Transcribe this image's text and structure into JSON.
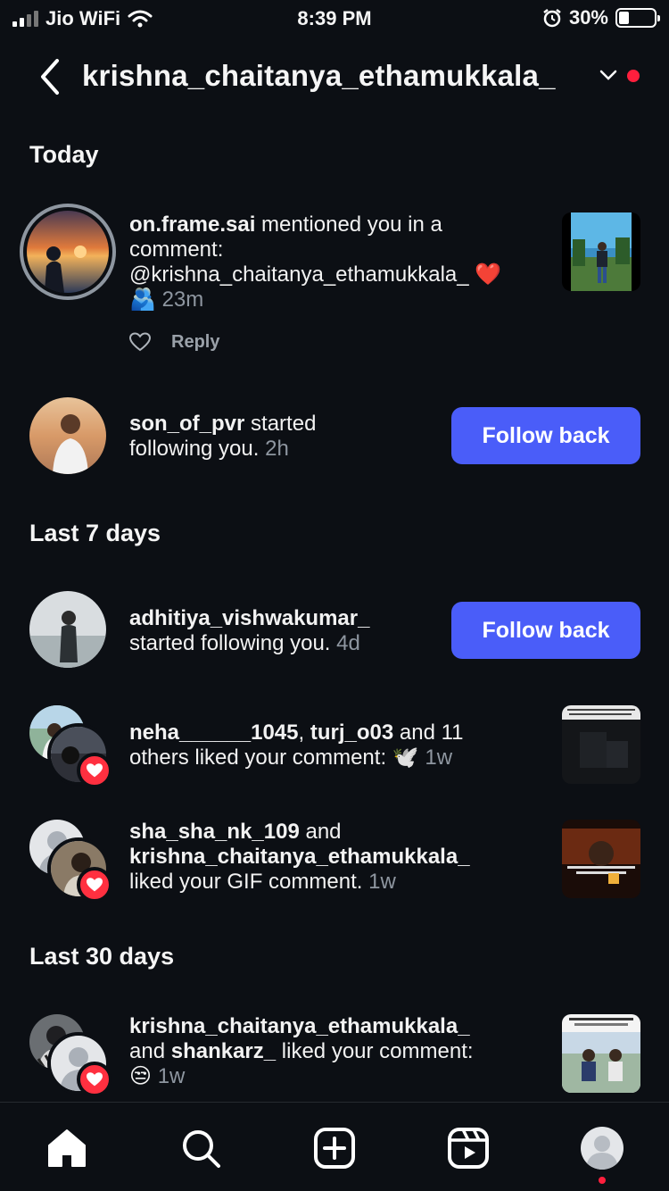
{
  "status_bar": {
    "carrier": "Jio WiFi",
    "time": "8:39 PM",
    "battery": "30%",
    "battery_level": 0.3
  },
  "header": {
    "username": "krishna_chaitanya_ethamukkala_"
  },
  "sections": {
    "today": "Today",
    "last7": "Last 7 days",
    "last30": "Last 30 days"
  },
  "notifications": {
    "mention": {
      "user": "on.frame.sai",
      "text1": " mentioned you in a",
      "text2": "comment:",
      "text3": "@krishna_chaitanya_ethamukkala_",
      "emoji1": "❤️",
      "emoji2": "🫂",
      "time": "23m",
      "reply_label": "Reply"
    },
    "follow1": {
      "user": "son_of_pvr",
      "text1": " started",
      "text2": "following you.",
      "time": "2h",
      "button": "Follow back"
    },
    "follow2": {
      "user": "adhitiya_vishwakumar_",
      "text": "started following you.",
      "time": "4d",
      "button": "Follow back"
    },
    "like1": {
      "user1": "neha______1045",
      "sep": ", ",
      "user2": "turj_o03",
      "text1": " and 11",
      "text2": "others liked your comment:",
      "emoji": "🕊️",
      "time": "1w"
    },
    "like2": {
      "user1": "sha_sha_nk_109",
      "text1": " and",
      "user2": "krishna_chaitanya_ethamukkala_",
      "text2": "liked your GIF comment.",
      "time": "1w"
    },
    "like3": {
      "user1": "krishna_chaitanya_ethamukkala_",
      "text1": "and ",
      "user2": "shankarz_",
      "text2": " liked your comment:",
      "emoji": "😒",
      "time": "1w"
    }
  },
  "nav": {
    "items": [
      "home-icon",
      "search-icon",
      "create-icon",
      "reels-icon",
      "profile-icon"
    ]
  },
  "colors": {
    "accent": "#4a5df9",
    "notification_red": "#ff1f3d",
    "background": "#0c0f14"
  }
}
